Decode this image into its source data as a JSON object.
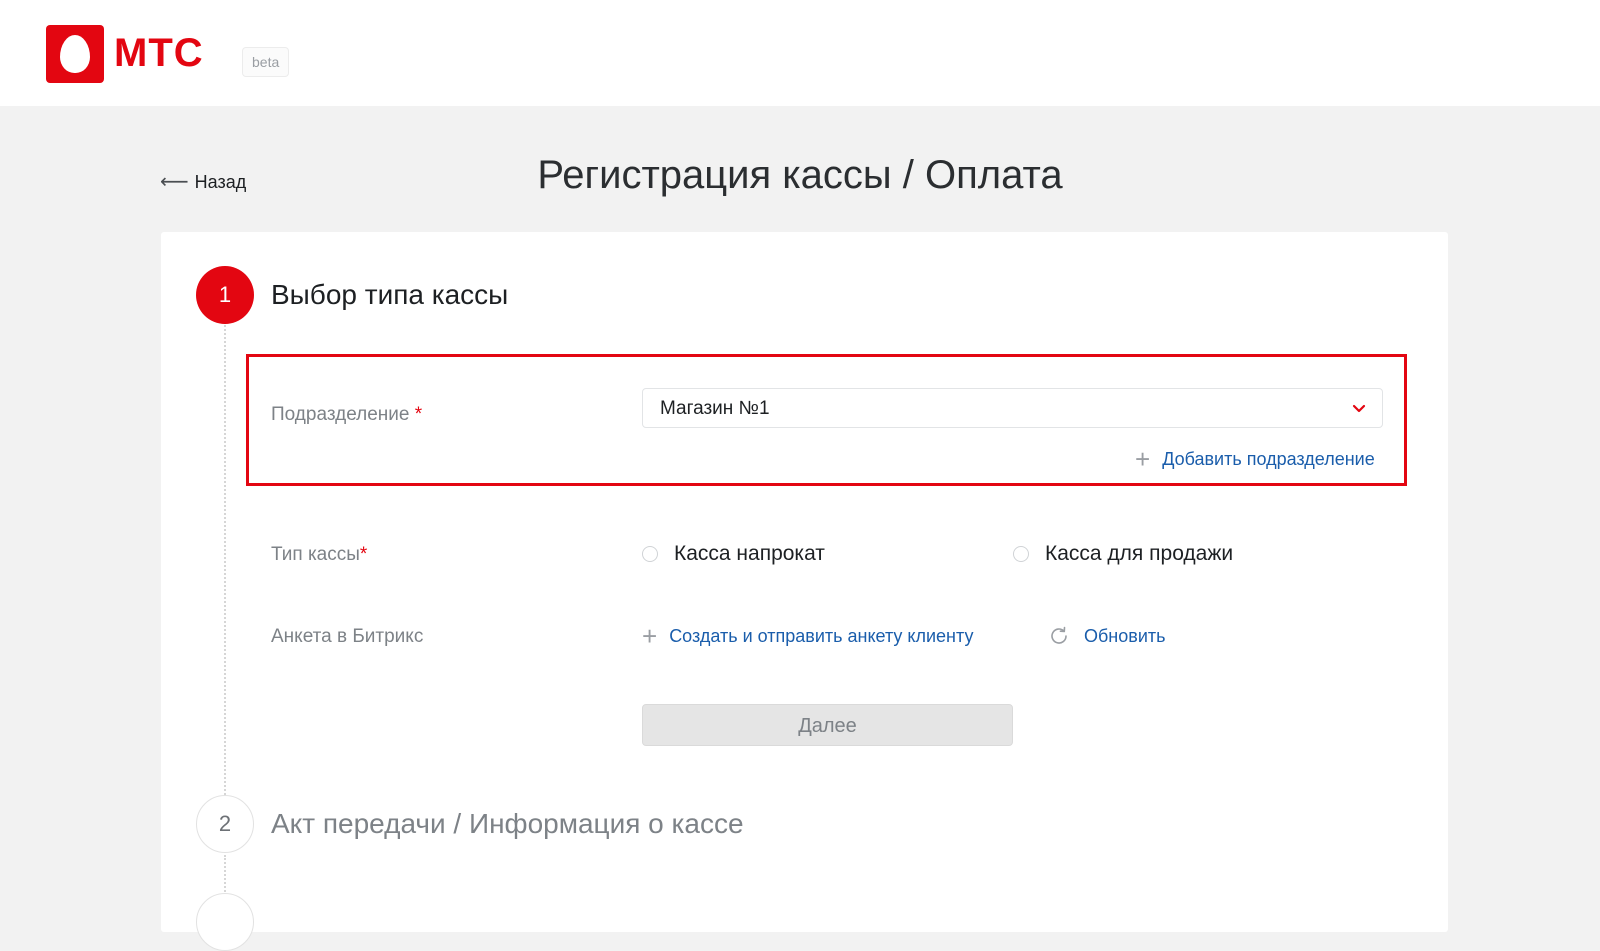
{
  "header": {
    "logo_text": "МТС",
    "beta_label": "beta"
  },
  "nav": {
    "back_label": "Назад",
    "back_arrow": "⟵"
  },
  "page": {
    "title": "Регистрация кассы / Оплата"
  },
  "steps": [
    {
      "number": "1",
      "title": "Выбор типа кассы",
      "state": "active"
    },
    {
      "number": "2",
      "title": "Акт передачи / Информация о кассе",
      "state": "inactive"
    }
  ],
  "form": {
    "division": {
      "label": "Подразделение",
      "required_mark": "*",
      "selected_value": "Магазин №1",
      "add_link": "Добавить подразделение"
    },
    "register_type": {
      "label": "Тип кассы",
      "required_mark": "*",
      "options": [
        {
          "label": "Касса напрокат",
          "selected": false
        },
        {
          "label": "Касса для продажи",
          "selected": false
        }
      ]
    },
    "bitrix_form": {
      "label": "Анкета в Битрикс",
      "create_link": "Создать и отправить анкету клиенту",
      "refresh_link": "Обновить"
    },
    "next_button": "Далее"
  },
  "icons": {
    "plus": "+",
    "chevron": "chevron-down-icon",
    "refresh": "refresh-icon"
  },
  "colors": {
    "brand_red": "#e30611",
    "link_blue": "#1a5dab",
    "muted_text": "#7d8287"
  }
}
